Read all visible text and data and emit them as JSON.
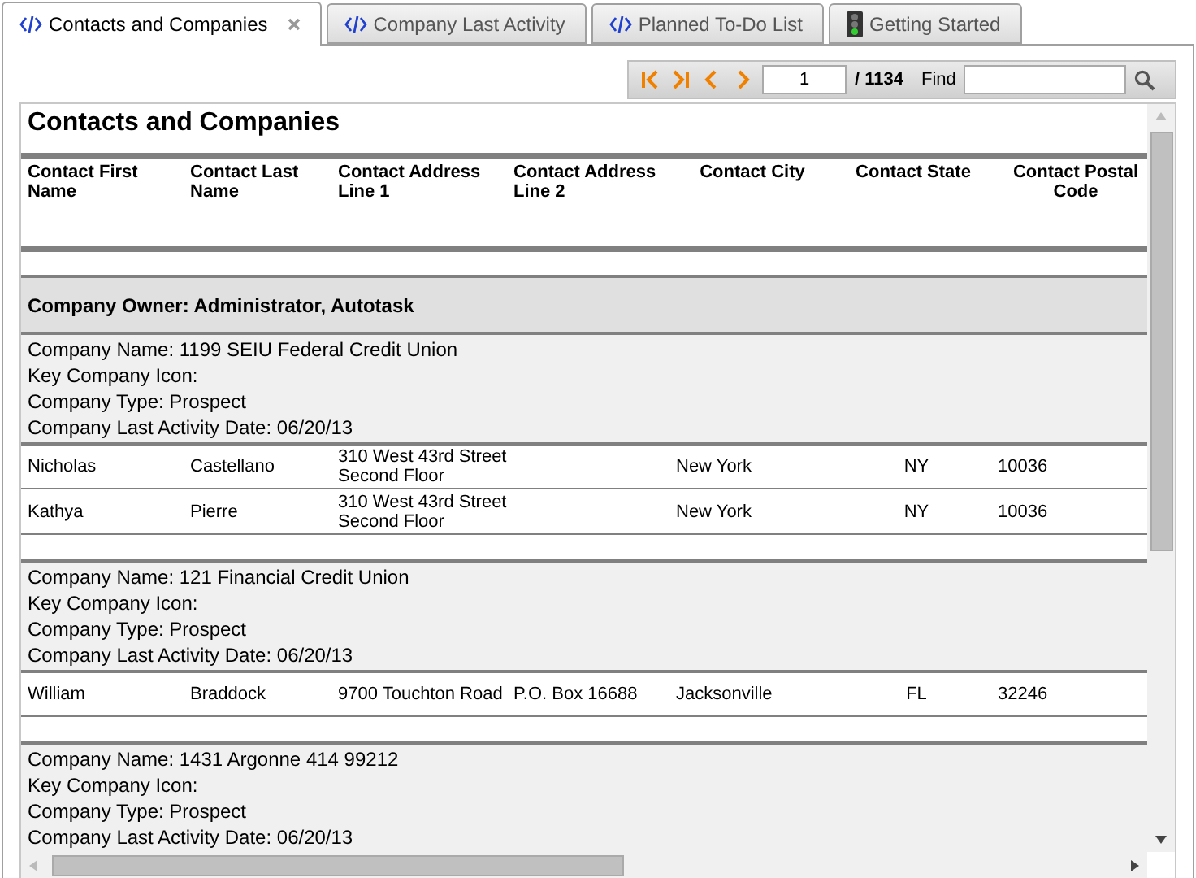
{
  "tabs": [
    {
      "label": "Contacts and Companies",
      "kind": "code",
      "selected": true,
      "closable": true
    },
    {
      "label": "Company Last Activity",
      "kind": "code",
      "selected": false,
      "closable": false
    },
    {
      "label": "Planned To-Do List",
      "kind": "code",
      "selected": false,
      "closable": false
    },
    {
      "label": "Getting Started",
      "kind": "traffic-light",
      "selected": false,
      "closable": false
    }
  ],
  "toolbar": {
    "page": "1",
    "total": "/ 1134",
    "find_label": "Find"
  },
  "report": {
    "title": "Contacts and Companies",
    "columns": [
      "Contact First Name",
      "Contact Last Name",
      "Contact Address Line 1",
      "Contact Address Line 2",
      "Contact City",
      "Contact State",
      "Contact Postal Code"
    ],
    "group": "Company Owner: Administrator, Autotask",
    "companies": [
      {
        "lines": [
          "Company Name: 1199 SEIU Federal Credit Union",
          "Key Company Icon:",
          "Company Type: Prospect",
          "Company Last Activity Date: 06/20/13"
        ],
        "contacts": [
          {
            "first_name": "Nicholas",
            "last_name": "Castellano",
            "address_1": "310 West 43rd Street Second Floor",
            "city": "New York",
            "state": "NY",
            "postal_code": "10036"
          },
          {
            "first_name": "Kathya",
            "last_name": "Pierre",
            "address_1": "310 West 43rd Street Second Floor",
            "city": "New York",
            "state": "NY",
            "postal_code": "10036"
          }
        ]
      },
      {
        "lines": [
          "Company Name: 121 Financial Credit Union",
          "Key Company Icon:",
          "Company Type: Prospect",
          "Company Last Activity Date: 06/20/13"
        ],
        "contacts": [
          {
            "first_name": "William",
            "last_name": "Braddock",
            "address_1": "9700 Touchton Road",
            "address_2": "P.O. Box 16688",
            "city": "Jacksonville",
            "state": "FL",
            "postal_code": "32246"
          }
        ]
      },
      {
        "lines": [
          "Company Name: 1431 Argonne 414 99212",
          "Key Company Icon:",
          "Company Type: Prospect",
          "Company Last Activity Date: 06/20/13"
        ]
      }
    ]
  }
}
